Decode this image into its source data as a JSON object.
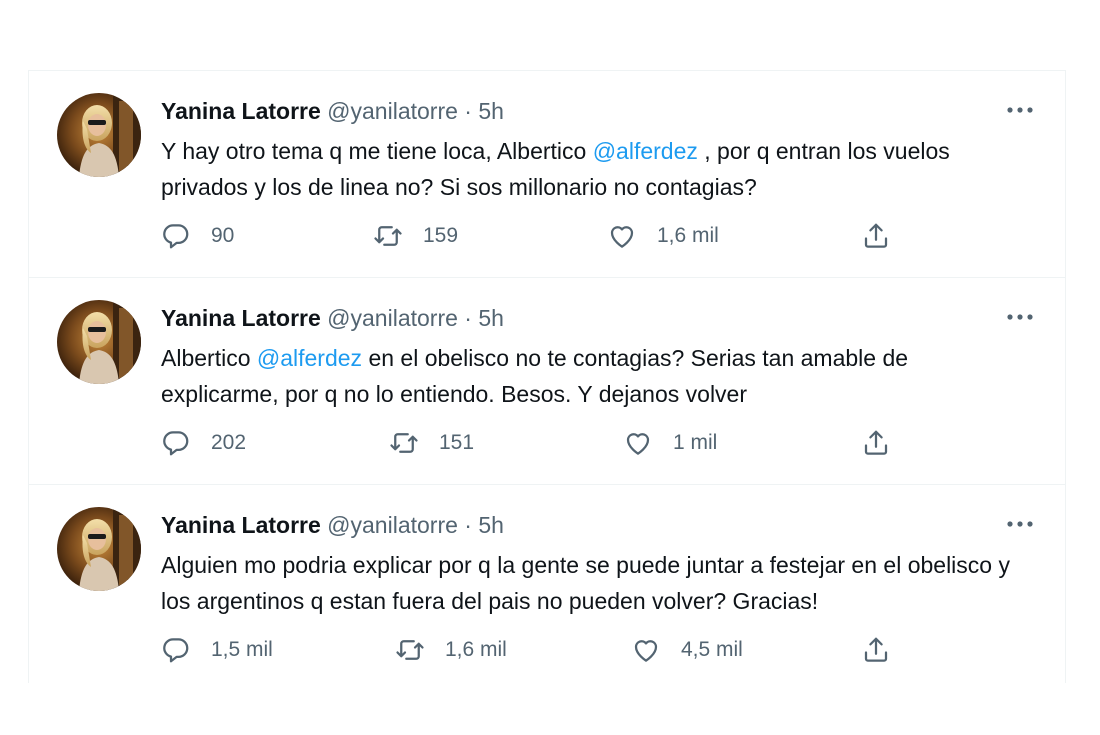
{
  "tweets": [
    {
      "author": {
        "name": "Yanina Latorre",
        "handle": "@yanilatorre",
        "time": "5h"
      },
      "separator": "·",
      "text_parts": [
        "Y hay otro tema q me tiene loca, Albertico ",
        "@alferdez",
        " , por q entran los vuelos privados y los de linea no? Si sos millonario no contagias?"
      ],
      "replies": "90",
      "retweets": "159",
      "likes": "1,6 mil"
    },
    {
      "author": {
        "name": "Yanina Latorre",
        "handle": "@yanilatorre",
        "time": "5h"
      },
      "separator": "·",
      "text_parts": [
        "Albertico ",
        "@alferdez",
        " en el obelisco no te contagias? Serias tan amable de explicarme, por q no lo entiendo. Besos. Y dejanos volver"
      ],
      "replies": "202",
      "retweets": "151",
      "likes": "1 mil"
    },
    {
      "author": {
        "name": "Yanina Latorre",
        "handle": "@yanilatorre",
        "time": "5h"
      },
      "separator": "·",
      "text_parts": [
        "Alguien mo podria explicar por q la gente se puede juntar a festejar en el obelisco y los argentinos q estan fuera del pais no pueden volver? Gracias!"
      ],
      "replies": "1,5 mil",
      "retweets": "1,6 mil",
      "likes": "4,5 mil"
    }
  ],
  "icons": {
    "reply": "reply-icon",
    "retweet": "retweet-icon",
    "like": "heart-icon",
    "share": "share-icon",
    "more": "more-icon"
  },
  "colors": {
    "mention": "#1d9bf0",
    "secondary_text": "#536471",
    "divider": "#eff3f4"
  }
}
